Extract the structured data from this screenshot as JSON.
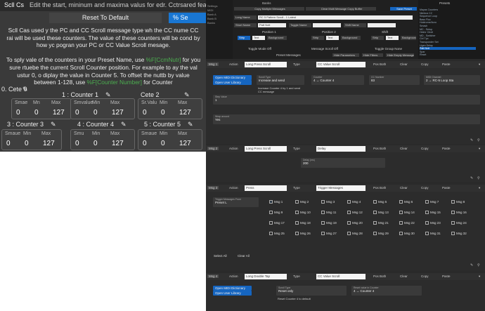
{
  "left": {
    "header": {
      "col1": "Scll Cs",
      "col2": "Edit the start, mininum and maxima valus for edr. Cctrsared feat lor"
    },
    "reset_label": "Reset To Default",
    "send_label": "% Se",
    "help": [
      {
        "pre": "Scll Cas used y the PC and CC Scroll message type wh the ",
        "green": "",
        "post": "CC nume CC"
      },
      {
        "pre": "rai will be used these counters. The value of these counters will be cond by",
        "green": "",
        "post": ""
      },
      {
        "pre": "how yc pogran your PC or CC Value Scroll mesage.",
        "green": "",
        "post": ""
      },
      {
        "pre": "",
        "green": "",
        "post": ""
      },
      {
        "pre": "To sply vale of the counters in your Preset Name, use ",
        "green": "%F[CcmNutr]",
        "post": " for you"
      },
      {
        "pre": "sure rtuebe the current Scroll Counter position. For example to ay the val",
        "green": "",
        "post": ""
      },
      {
        "pre": "ustur 0, o diplay the value in Counter 5. To offset the nuttb by value",
        "green": "",
        "post": ""
      },
      {
        "pre": "between 1-128, use ",
        "green": "%F[Counter Number]",
        "post": " for Counter"
      }
    ],
    "counters": [
      {
        "title": "0. Cete 0",
        "labels": [
          "Smae",
          "Mn",
          "Max"
        ],
        "values": [
          "0",
          "0",
          "127"
        ]
      },
      {
        "title": "1 : Counter 1",
        "labels": [
          "Smvalue",
          "Min",
          "Max"
        ],
        "values": [
          "0",
          "0",
          "127"
        ]
      },
      {
        "title": "Cete 2",
        "labels": [
          "Sr.Valu",
          "Min",
          "Max"
        ],
        "values": [
          "0",
          "0",
          "127"
        ]
      },
      {
        "title": "3 : Counter 3",
        "labels": [
          "Smaue",
          "Min",
          "Max"
        ],
        "values": [
          "0",
          "0",
          "127"
        ]
      },
      {
        "title": "4 : Counter 4",
        "labels": [
          "Smu",
          "Min",
          "Max"
        ],
        "values": [
          "0",
          "0",
          "127"
        ]
      },
      {
        "title": "5 : Counter 5",
        "labels": [
          "Smaue",
          "Min",
          "Max"
        ],
        "values": [
          "0",
          "0",
          "127"
        ]
      }
    ]
  },
  "right": {
    "banks_title": "Banks",
    "presets_title": "Presets",
    "nav_items": [
      "Settings",
      "MIDI",
      "Bank A",
      "Bank B",
      "Banks"
    ],
    "copy_multi": "Copy Multiple Messages",
    "clear_multi": "Clear Multi Message Copy Buffer",
    "save_preset": "Save Preset",
    "long_name_label": "Long Name",
    "long_name_value": "RC 5 Pattern Scroll - 1 Latest",
    "short_name_label": "Short Name",
    "short_name_value": "Patt Nxtt",
    "toggle_name_label": "Toggle Name",
    "shift_name_label": "Shift Name",
    "positions": [
      "Position 1",
      "Position 2",
      "Shift"
    ],
    "pos_buttons": [
      "Strip",
      "Text",
      "Background"
    ],
    "toggle_mode": "Toggle Mode Off",
    "msg_scroll": "Message Scroll Off",
    "toggle_group": "Toggle Group None",
    "preset_messages": "Preset Messages",
    "hide_params": "Hide Parameters",
    "hide_filters": "Hide Filters",
    "hide_empty": "Hide Empty Messages",
    "preset_list": [
      "Mayas Counters",
      "Nimbus C2",
      "Sequence Loop",
      "Bass Fluc",
      "Holdrome/Acro",
      "Smash",
      "MC - Setup",
      "Helmr Ctroll",
      "MD - Switcher",
      "Ctrl Tpc",
      "Transponder Set",
      "Ugen Delay",
      "Patt Nxtt",
      "Spar",
      "Reset"
    ],
    "messages": [
      {
        "tag": "Msg 1",
        "action_label": "Action",
        "action": "Long Press Scroll",
        "type_label": "Type",
        "type": "CC Value Scroll",
        "buttons": [
          "Pos Both",
          "Clear",
          "Copy",
          "Paste"
        ]
      },
      {
        "tag": "Msg 2",
        "action_label": "Action",
        "action": "Long Press Scroll",
        "type_label": "Type",
        "type": "Delay",
        "buttons": [
          "Pos Both",
          "Clear",
          "Copy",
          "Paste"
        ]
      },
      {
        "tag": "Msg 3",
        "action_label": "Action",
        "action": "Press",
        "type_label": "Type",
        "type": "Trigger Messages",
        "buttons": [
          "Pos Both",
          "Clear",
          "Copy",
          "Paste"
        ]
      },
      {
        "tag": "Msg 4",
        "action_label": "Action",
        "action": "Long Double Tap",
        "type_label": "Type",
        "type": "CC Value Scroll",
        "buttons": [
          "Pos Both",
          "Clear",
          "Copy",
          "Paste"
        ]
      }
    ],
    "msg1": {
      "open_dict": "Open MIDI Dictionary",
      "open_lib": "Open User Library",
      "scroll_type_label": "Scroll Type",
      "scroll_type": "Increase and send",
      "scroll_note": "Increase Counter 4 by 1 and send CC message",
      "counter_label": "Counter",
      "counter": "4 → Counter 4",
      "cc_label": "CC Number",
      "cc": "83",
      "channel_label": "MIDI Channel",
      "channel": "2 → RC-5 Loop Sta",
      "step_label": "Step Value",
      "step": "1",
      "wrap_label": "Wrap around",
      "wrap": "Yes"
    },
    "msg2": {
      "delay_label": "Delay (ms)",
      "delay": "200"
    },
    "msg3": {
      "trigger_label": "Trigger Messages From",
      "trigger": "Preset L",
      "checks": [
        "Msg 1",
        "Msg 2",
        "Msg 3",
        "Msg 4",
        "Msg 5",
        "Msg 6",
        "Msg 7",
        "Msg 8",
        "Msg 9",
        "Msg 10",
        "Msg 11",
        "Msg 12",
        "Msg 13",
        "Msg 14",
        "Msg 15",
        "Msg 16",
        "Msg 17",
        "Msg 18",
        "Msg 19",
        "Msg 20",
        "Msg 21",
        "Msg 22",
        "Msg 23",
        "Msg 24",
        "Msg 25",
        "Msg 26",
        "Msg 27",
        "Msg 28",
        "Msg 29",
        "Msg 30",
        "Msg 31",
        "Msg 32"
      ],
      "select_all": "Select All",
      "clear_all": "Clear All"
    },
    "msg4": {
      "open_dict": "Open MIDI Dictionary",
      "open_lib": "Open User Library",
      "scroll_type_label": "Scroll Type",
      "scroll_type": "Reset only",
      "reset_label": "Reset value in Counter",
      "reset": "4 → Counter 4",
      "note": "Reset Counter 4 to default"
    }
  }
}
